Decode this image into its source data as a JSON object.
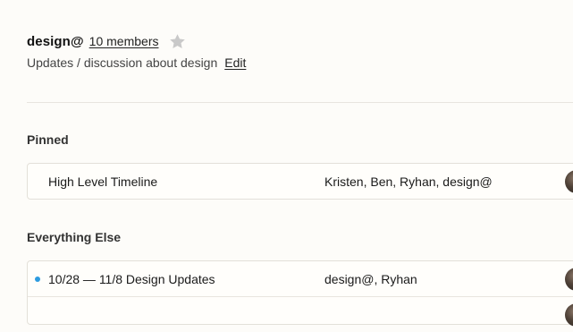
{
  "group": {
    "name": "design@",
    "members_link": "10 members",
    "description": "Updates / discussion about design",
    "edit_label": "Edit"
  },
  "icons": {
    "star": "star-icon",
    "star_color": "#c9c9c9"
  },
  "pinned": {
    "heading": "Pinned",
    "rows": [
      {
        "title": "High Level Timeline",
        "people": "Kristen, Ben, Ryhan, design@",
        "unread": false
      }
    ]
  },
  "everything_else": {
    "heading": "Everything Else",
    "rows": [
      {
        "title": "10/28 — 11/8 Design Updates",
        "people": "design@, Ryhan",
        "unread": true
      }
    ]
  },
  "colors": {
    "background": "#fdfcf9",
    "unread_dot": "#2d9be0"
  }
}
